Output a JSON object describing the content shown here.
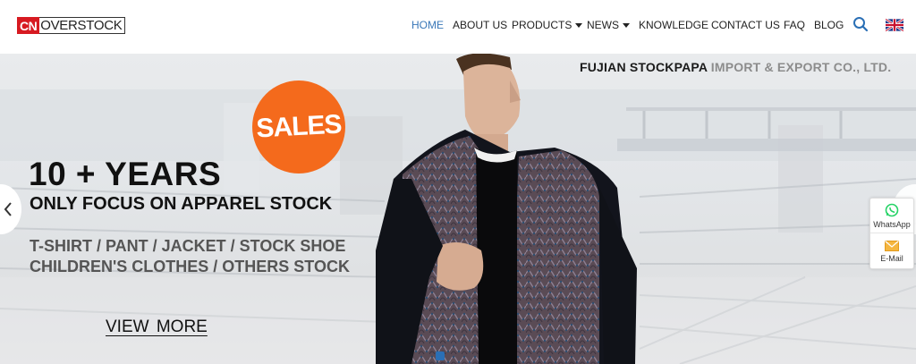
{
  "header": {
    "logo": {
      "badge": "CN",
      "text": "OVERSTOCK"
    },
    "nav": [
      {
        "label": "HOME",
        "active": true,
        "dropdown": false
      },
      {
        "label": "ABOUT US",
        "active": false,
        "dropdown": false
      },
      {
        "label": "PRODUCTS",
        "active": false,
        "dropdown": true
      },
      {
        "label": "NEWS",
        "active": false,
        "dropdown": true
      },
      {
        "label": "KNOWLEDGE",
        "active": false,
        "dropdown": false
      },
      {
        "label": "CONTACT US",
        "active": false,
        "dropdown": false
      },
      {
        "label": "FAQ",
        "active": false,
        "dropdown": false
      },
      {
        "label": "BLOG",
        "active": false,
        "dropdown": false
      }
    ],
    "icons": {
      "search": "search-icon",
      "language": "uk-flag-icon"
    },
    "colors": {
      "active_nav": "#3a78b8",
      "logo_red": "#d71a21"
    }
  },
  "hero": {
    "company_bold": "FUJIAN STOCKPAPA",
    "company_rest": " IMPORT & EXPORT CO., LTD.",
    "badge": "SALES",
    "headline": "10 + YEARS",
    "subhead": "ONLY FOCUS ON APPAREL STOCK",
    "categories_line1": "T-SHIRT / PANT / JACKET  /  STOCK SHOE",
    "categories_line2": "CHILDREN'S CLOTHES / OTHERS STOCK",
    "cta": "VIEW  MORE",
    "colors": {
      "badge": "#f46a1c",
      "dot": "#2a6fb5"
    }
  },
  "side_widget": {
    "whatsapp_label": "WhatsApp",
    "email_label": "E-Mail"
  }
}
